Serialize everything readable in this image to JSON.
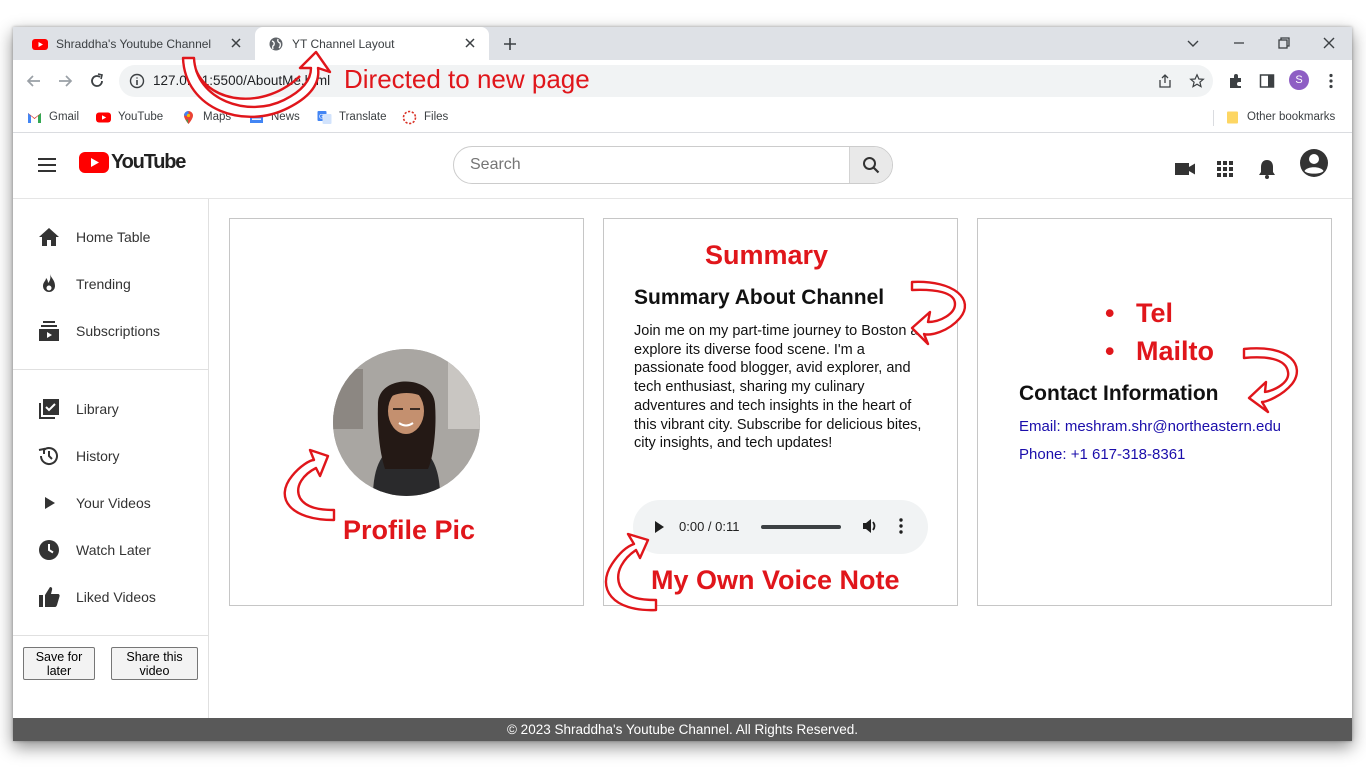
{
  "browser": {
    "tabs": [
      {
        "title": "Shraddha's Youtube Channel",
        "favicon": "youtube-favicon",
        "active": false
      },
      {
        "title": "YT Channel Layout",
        "favicon": "globe-icon",
        "active": true
      }
    ],
    "url": "127.0.0.1:5500/AboutMe.html",
    "profile_initial": "S",
    "bookmarks": [
      {
        "label": "Gmail",
        "icon": "gmail-icon"
      },
      {
        "label": "YouTube",
        "icon": "youtube-icon"
      },
      {
        "label": "Maps",
        "icon": "maps-icon"
      },
      {
        "label": "News",
        "icon": "news-icon"
      },
      {
        "label": "Translate",
        "icon": "translate-icon"
      },
      {
        "label": "Files",
        "icon": "files-icon"
      }
    ],
    "other_bookmarks": "Other bookmarks"
  },
  "header": {
    "logo_text": "YouTube",
    "search_placeholder": "Search"
  },
  "sidebar": {
    "items": [
      {
        "label": "Home Table",
        "icon": "home-icon"
      },
      {
        "label": "Trending",
        "icon": "fire-icon"
      },
      {
        "label": "Subscriptions",
        "icon": "subscriptions-icon"
      },
      {
        "label": "Library",
        "icon": "library-icon"
      },
      {
        "label": "History",
        "icon": "history-icon"
      },
      {
        "label": "Your Videos",
        "icon": "play-icon"
      },
      {
        "label": "Watch Later",
        "icon": "clock-icon"
      },
      {
        "label": "Liked Videos",
        "icon": "thumbs-up-icon"
      }
    ],
    "save_button": "Save for later",
    "share_button": "Share this video"
  },
  "summary": {
    "title": "Summary About Channel",
    "text": "Join me on my part-time journey to Boston as I explore its diverse food scene. I'm a passionate food blogger, avid explorer, and tech enthusiast, sharing my culinary adventures and tech insights in the heart of this vibrant city. Subscribe for delicious bites, city insights, and tech updates!",
    "audio_time": "0:00 / 0:11"
  },
  "contact": {
    "title": "Contact Information",
    "email": "Email: meshram.shr@northeastern.edu",
    "phone": "Phone: +1 617-318-8361"
  },
  "footer": {
    "text": "© 2023 Shraddha's Youtube Channel. All Rights Reserved."
  },
  "annotations": {
    "directed": "Directed to new page",
    "summary": "Summary",
    "tel": "Tel",
    "mailto": "Mailto",
    "profile_pic": "Profile Pic",
    "voice_note": "My Own Voice Note",
    "color": "#e0161b"
  }
}
